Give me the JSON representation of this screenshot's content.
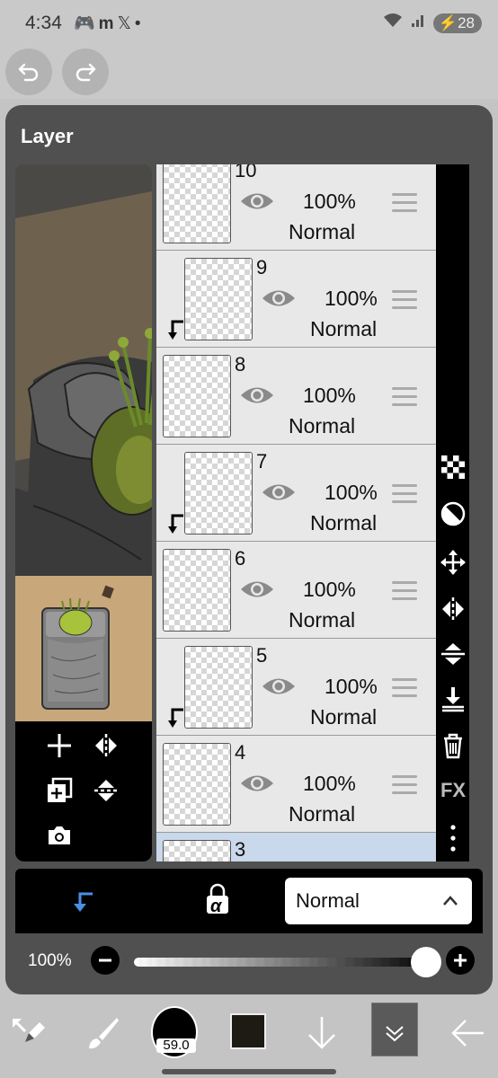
{
  "status_bar": {
    "time": "4:34",
    "left_icons": [
      "discord-icon",
      "m-icon",
      "x-icon"
    ],
    "dot": "•",
    "battery": "28"
  },
  "panel": {
    "title": "Layer"
  },
  "layers": [
    {
      "number": "10",
      "opacity": "100%",
      "blend": "Normal",
      "clipped": false
    },
    {
      "number": "9",
      "opacity": "100%",
      "blend": "Normal",
      "clipped": true
    },
    {
      "number": "8",
      "opacity": "100%",
      "blend": "Normal",
      "clipped": false
    },
    {
      "number": "7",
      "opacity": "100%",
      "blend": "Normal",
      "clipped": true
    },
    {
      "number": "6",
      "opacity": "100%",
      "blend": "Normal",
      "clipped": false
    },
    {
      "number": "5",
      "opacity": "100%",
      "blend": "Normal",
      "clipped": true
    },
    {
      "number": "4",
      "opacity": "100%",
      "blend": "Normal",
      "clipped": false
    },
    {
      "number": "3",
      "opacity": "100%",
      "blend": "Normal",
      "clipped": false,
      "selected": true
    }
  ],
  "right_toolbar": {
    "fx_label": "FX",
    "icons": [
      "transparency-checker-icon",
      "invert-icon",
      "move-icon",
      "flip-horizontal-icon",
      "flip-vertical-icon",
      "merge-down-icon",
      "trash-icon",
      "fx-icon",
      "more-icon"
    ]
  },
  "blend_row": {
    "blend_mode": "Normal",
    "icons": [
      "clipping-arrow-icon",
      "alpha-lock-icon",
      "chevron-up-icon"
    ],
    "alpha_lock_label": "α"
  },
  "opacity_row": {
    "label": "100%",
    "value": 1.0
  },
  "bottom_bar": {
    "brush_size": "59.0",
    "color": "#1e1a14"
  },
  "colors": {
    "panel_bg": "#505050",
    "selected_layer": "#c9d8ea",
    "accent_blue": "#4a8fe7"
  }
}
